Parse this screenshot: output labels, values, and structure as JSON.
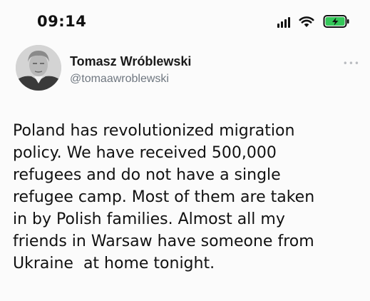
{
  "status_bar": {
    "time": "09:14",
    "icons": [
      "signal-icon",
      "wifi-icon",
      "battery-charging-icon"
    ]
  },
  "tweet": {
    "author": {
      "name": "Tomasz Wróblewski",
      "handle": "@tomaawroblewski",
      "avatar": "avatar-photo"
    },
    "more_icon": "more-options-icon",
    "more_glyph": "•••",
    "text": "Poland has revolutionized migration\npolicy. We have received 500,000\nrefugees and do not have a single\nrefugee camp. Most of them are taken\nin by Polish families. Almost all my\nfriends in Warsaw have someone from\nUkraine  at home tonight."
  },
  "colors": {
    "text": "#111111",
    "handle": "#6f7780",
    "battery_charge": "#34c759",
    "background": "#fbfbfb"
  }
}
